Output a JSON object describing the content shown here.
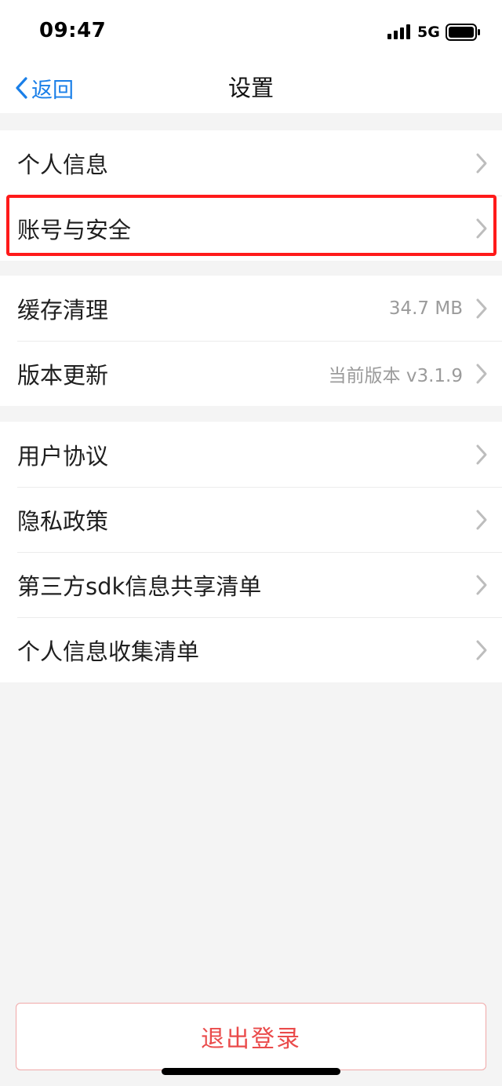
{
  "status_bar": {
    "time": "09:47",
    "network": "5G",
    "signal_icon": "signal-bars-icon",
    "battery_icon": "battery-icon"
  },
  "nav": {
    "back_label": "返回",
    "back_icon": "chevron-left-icon",
    "title": "设置"
  },
  "groups": [
    {
      "items": [
        {
          "label": "个人信息",
          "value": ""
        },
        {
          "label": "账号与安全",
          "value": ""
        }
      ]
    },
    {
      "items": [
        {
          "label": "缓存清理",
          "value": "34.7 MB"
        },
        {
          "label": "版本更新",
          "value": "当前版本 v3.1.9"
        }
      ]
    },
    {
      "items": [
        {
          "label": "用户协议",
          "value": ""
        },
        {
          "label": "隐私政策",
          "value": ""
        },
        {
          "label": "第三方sdk信息共享清单",
          "value": ""
        },
        {
          "label": "个人信息收集清单",
          "value": ""
        }
      ]
    }
  ],
  "logout": {
    "label": "退出登录"
  },
  "colors": {
    "accent": "#1a7fe8",
    "danger": "#ea4b4b",
    "highlight": "#ff1a1a",
    "background": "#f4f4f4"
  }
}
